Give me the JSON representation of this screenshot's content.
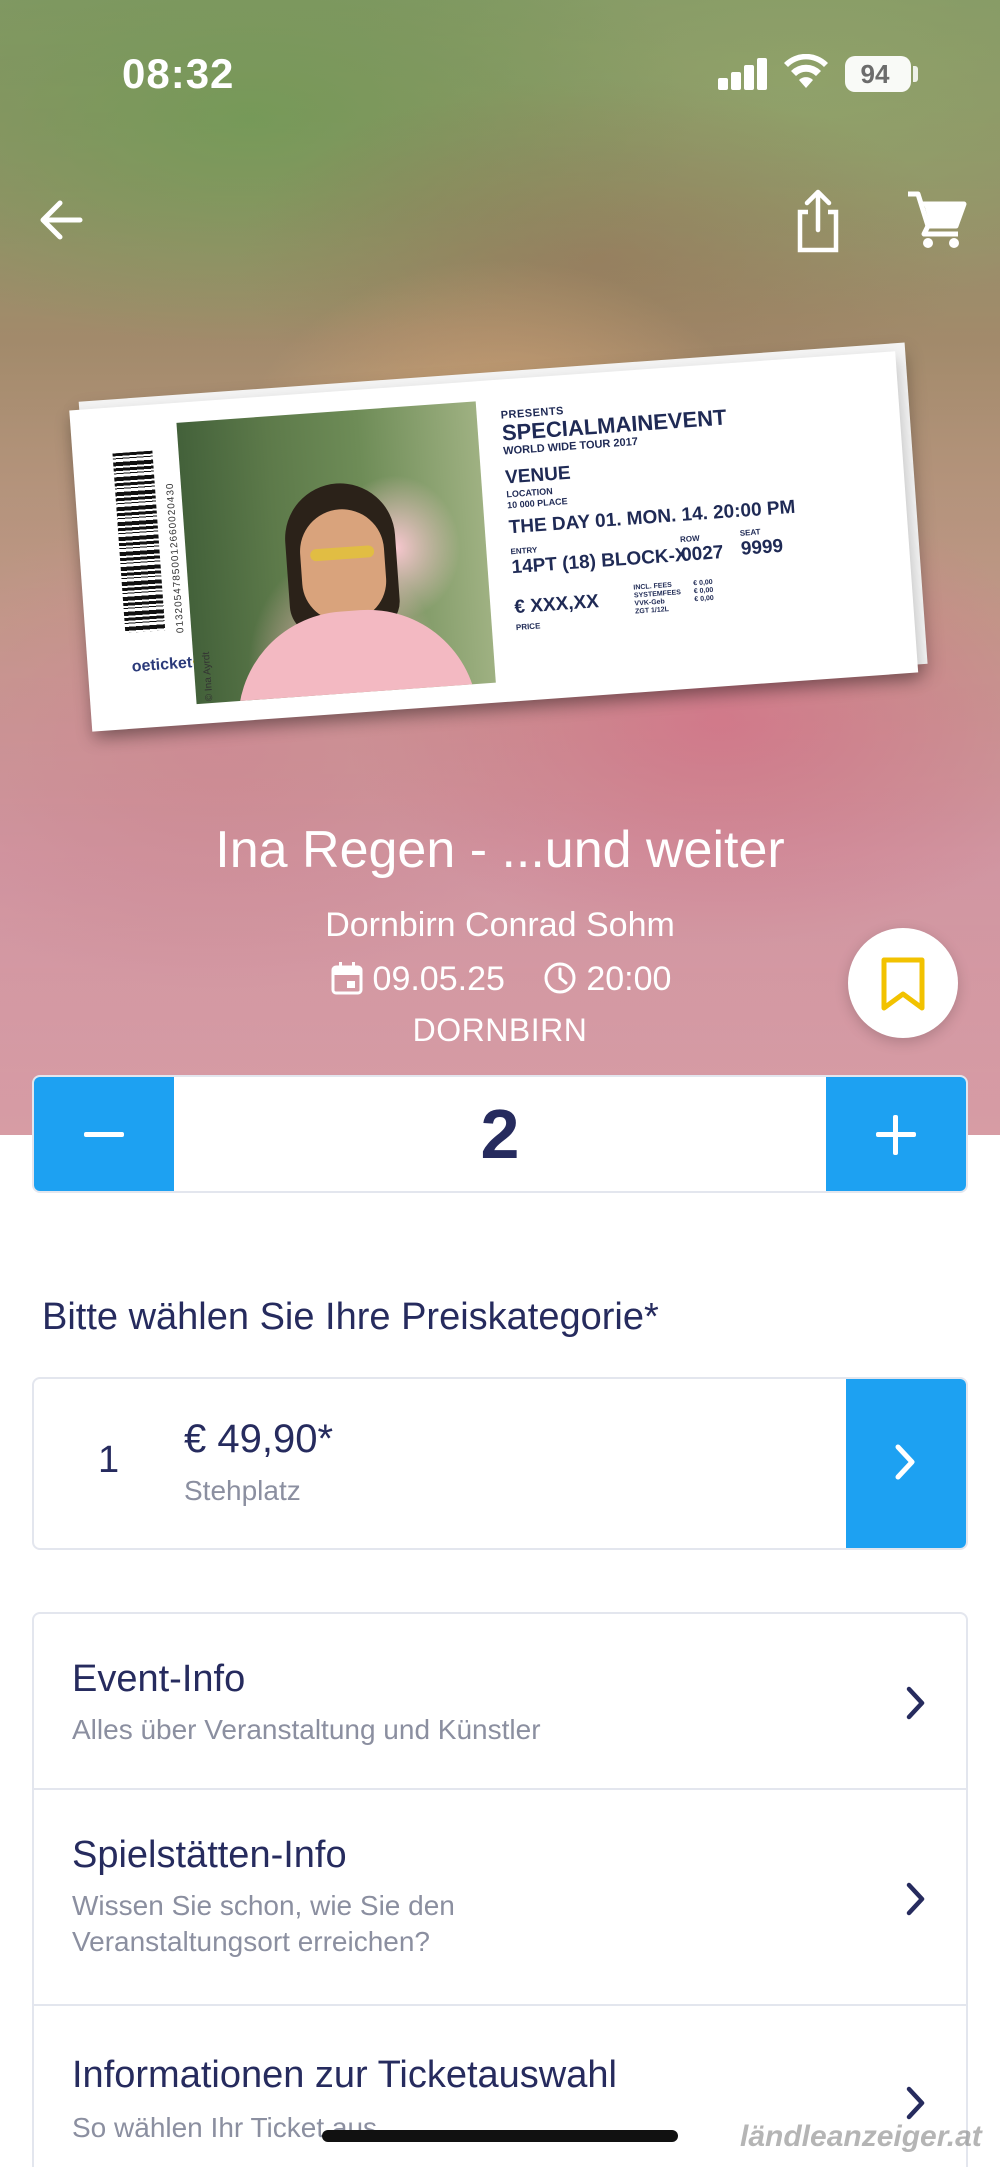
{
  "status_bar": {
    "time": "08:32",
    "battery": "94"
  },
  "ticket": {
    "presents": "PRESENTS",
    "event": "SPECIALMAINEVENT",
    "tour": "WORLD WIDE TOUR 2017",
    "venue": "VENUE",
    "location_l1": "LOCATION",
    "location_l2": "10 000 PLACE",
    "day": "THE DAY 01. MON. 14. 20:00 PM",
    "entry_label": "ENTRY",
    "entry": "14PT (18) BLOCK-X",
    "row_label": "ROW",
    "row": "0027",
    "seat_label": "SEAT",
    "seat": "9999",
    "price": "€ XXX,XX",
    "price_label": "PRICE",
    "fees": [
      "INCL. FEES",
      "SYSTEMFEES",
      "VVK-Geb",
      "ZGT 1/12L"
    ],
    "fees_values": [
      "€ 0,00",
      "€ 0,00",
      "€ 0,00"
    ],
    "barcode_number": "01320547850012660020430",
    "brand": "oeticket",
    "photo_caption": "© Ina Ayrdt"
  },
  "event": {
    "title": "Ina Regen - ...und weiter",
    "venue": "Dornbirn Conrad Sohm",
    "date": "09.05.25",
    "time": "20:00",
    "city": "DORNBIRN"
  },
  "quantity": {
    "value": "2"
  },
  "price_section": {
    "heading": "Bitte wählen Sie Ihre Preiskategorie*",
    "items": [
      {
        "index": "1",
        "amount": "€ 49,90*",
        "label": "Stehplatz"
      }
    ]
  },
  "info": [
    {
      "title": "Event-Info",
      "subtitle": "Alles über Veranstaltung und Künstler"
    },
    {
      "title": "Spielstätten-Info",
      "subtitle": "Wissen Sie schon, wie Sie den Veranstaltungsort erreichen?"
    },
    {
      "title": "Informationen zur Ticketauswahl",
      "subtitle": "So wählen Ihr Ticket aus"
    }
  ],
  "watermark": "ländleanzeiger.at",
  "colors": {
    "accent": "#1da1f2",
    "text_primary": "#262b5e",
    "text_secondary": "#8b8fa0",
    "bookmark": "#f2c200"
  }
}
